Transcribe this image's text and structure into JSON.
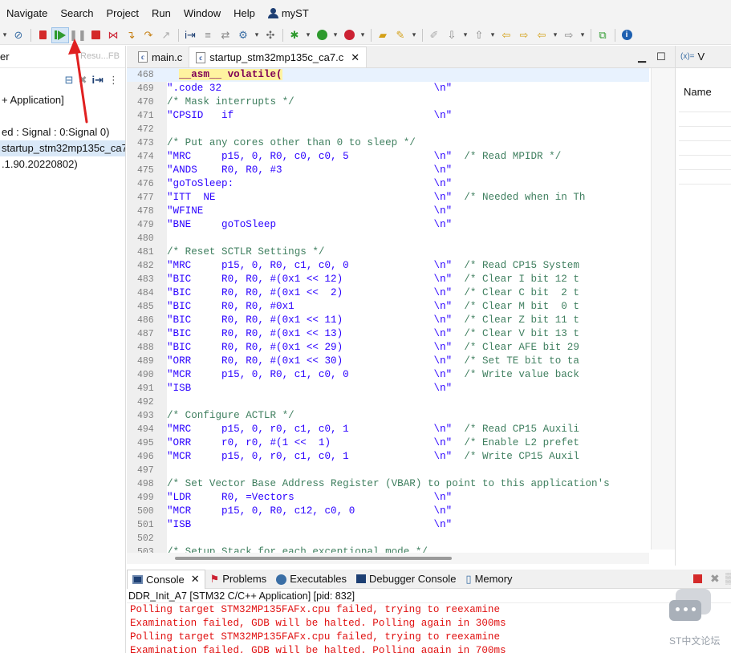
{
  "menubar": {
    "items": [
      "Navigate",
      "Search",
      "Project",
      "Run",
      "Window",
      "Help"
    ],
    "user": "myST"
  },
  "toolbar": {
    "icons": [
      "debug-stop-icon",
      "resume-icon",
      "suspend-icon",
      "terminate-icon",
      "disconnect-icon",
      "step-into-icon",
      "step-over-icon",
      "step-return-icon",
      "instruction-step-icon",
      "use-step-filters-icon",
      "restart-icon",
      "build-icon",
      "run-icon",
      "debug-icon",
      "open-folder-icon",
      "search-icon",
      "back-icon",
      "forward-icon",
      "info-icon"
    ],
    "colors": {
      "highlight": "#d5e6f6",
      "stop_red": "#d42a2a",
      "run_green": "#2e9a2e"
    }
  },
  "left_panel": {
    "title": "er",
    "ghost_text": "Resu...FB",
    "rows": [
      "+ Application]",
      "",
      "ed : Signal : 0:Signal 0)",
      "  startup_stm32mp135c_ca7",
      ".1.90.20220802)"
    ],
    "selected_row": 3
  },
  "editor": {
    "tabs": [
      {
        "label": "main.c",
        "active": false
      },
      {
        "label": "startup_stm32mp135c_ca7.c",
        "active": true
      }
    ],
    "current_line": 468,
    "lines": [
      {
        "n": "468",
        "segments": [
          {
            "t": "  ",
            "k": "s"
          },
          {
            "t": "__asm__ volatile(",
            "k": "kw"
          }
        ]
      },
      {
        "n": "469",
        "segments": [
          {
            "t": "\".code 32                                   \\n\"",
            "k": "s"
          }
        ]
      },
      {
        "n": "470",
        "segments": [
          {
            "t": "/* Mask interrupts */",
            "k": "c"
          }
        ]
      },
      {
        "n": "471",
        "segments": [
          {
            "t": "\"CPSID   if                                 \\n\"",
            "k": "s"
          }
        ]
      },
      {
        "n": "472",
        "segments": [
          {
            "t": "",
            "k": "s"
          }
        ]
      },
      {
        "n": "473",
        "segments": [
          {
            "t": "/* Put any cores other than 0 to sleep */",
            "k": "c"
          }
        ]
      },
      {
        "n": "474",
        "segments": [
          {
            "t": "\"MRC     p15, 0, R0, c0, c0, 5              \\n\"  ",
            "k": "s"
          },
          {
            "t": "/* Read MPIDR */",
            "k": "c"
          }
        ]
      },
      {
        "n": "475",
        "segments": [
          {
            "t": "\"ANDS    R0, R0, #3                         \\n\"",
            "k": "s"
          }
        ]
      },
      {
        "n": "476",
        "segments": [
          {
            "t": "\"goToSleep:                                 \\n\"",
            "k": "s"
          }
        ]
      },
      {
        "n": "477",
        "segments": [
          {
            "t": "\"ITT  NE                                    \\n\"  ",
            "k": "s"
          },
          {
            "t": "/* Needed when in Th",
            "k": "c"
          }
        ]
      },
      {
        "n": "478",
        "segments": [
          {
            "t": "\"WFINE                                      \\n\"",
            "k": "s"
          }
        ]
      },
      {
        "n": "479",
        "segments": [
          {
            "t": "\"BNE     goToSleep                          \\n\"",
            "k": "s"
          }
        ]
      },
      {
        "n": "480",
        "segments": [
          {
            "t": "",
            "k": "s"
          }
        ]
      },
      {
        "n": "481",
        "segments": [
          {
            "t": "/* Reset SCTLR Settings */",
            "k": "c"
          }
        ]
      },
      {
        "n": "482",
        "segments": [
          {
            "t": "\"MRC     p15, 0, R0, c1, c0, 0              \\n\"  ",
            "k": "s"
          },
          {
            "t": "/* Read CP15 System",
            "k": "c"
          }
        ]
      },
      {
        "n": "483",
        "segments": [
          {
            "t": "\"BIC     R0, R0, #(0x1 << 12)               \\n\"  ",
            "k": "s"
          },
          {
            "t": "/* Clear I bit 12 t",
            "k": "c"
          }
        ]
      },
      {
        "n": "484",
        "segments": [
          {
            "t": "\"BIC     R0, R0, #(0x1 <<  2)               \\n\"  ",
            "k": "s"
          },
          {
            "t": "/* Clear C bit  2 t",
            "k": "c"
          }
        ]
      },
      {
        "n": "485",
        "segments": [
          {
            "t": "\"BIC     R0, R0, #0x1                       \\n\"  ",
            "k": "s"
          },
          {
            "t": "/* Clear M bit  0 t",
            "k": "c"
          }
        ]
      },
      {
        "n": "486",
        "segments": [
          {
            "t": "\"BIC     R0, R0, #(0x1 << 11)               \\n\"  ",
            "k": "s"
          },
          {
            "t": "/* Clear Z bit 11 t",
            "k": "c"
          }
        ]
      },
      {
        "n": "487",
        "segments": [
          {
            "t": "\"BIC     R0, R0, #(0x1 << 13)               \\n\"  ",
            "k": "s"
          },
          {
            "t": "/* Clear V bit 13 t",
            "k": "c"
          }
        ]
      },
      {
        "n": "488",
        "segments": [
          {
            "t": "\"BIC     R0, R0, #(0x1 << 29)               \\n\"  ",
            "k": "s"
          },
          {
            "t": "/* Clear AFE bit 29",
            "k": "c"
          }
        ]
      },
      {
        "n": "489",
        "segments": [
          {
            "t": "\"ORR     R0, R0, #(0x1 << 30)               \\n\"  ",
            "k": "s"
          },
          {
            "t": "/* Set TE bit to ta",
            "k": "c"
          }
        ]
      },
      {
        "n": "490",
        "segments": [
          {
            "t": "\"MCR     p15, 0, R0, c1, c0, 0              \\n\"  ",
            "k": "s"
          },
          {
            "t": "/* Write value back",
            "k": "c"
          }
        ]
      },
      {
        "n": "491",
        "segments": [
          {
            "t": "\"ISB                                        \\n\"",
            "k": "s"
          }
        ]
      },
      {
        "n": "492",
        "segments": [
          {
            "t": "",
            "k": "s"
          }
        ]
      },
      {
        "n": "493",
        "segments": [
          {
            "t": "/* Configure ACTLR */",
            "k": "c"
          }
        ]
      },
      {
        "n": "494",
        "segments": [
          {
            "t": "\"MRC     p15, 0, r0, c1, c0, 1              \\n\"  ",
            "k": "s"
          },
          {
            "t": "/* Read CP15 Auxili",
            "k": "c"
          }
        ]
      },
      {
        "n": "495",
        "segments": [
          {
            "t": "\"ORR     r0, r0, #(1 <<  1)                 \\n\"  ",
            "k": "s"
          },
          {
            "t": "/* Enable L2 prefet",
            "k": "c"
          }
        ]
      },
      {
        "n": "496",
        "segments": [
          {
            "t": "\"MCR     p15, 0, r0, c1, c0, 1              \\n\"  ",
            "k": "s"
          },
          {
            "t": "/* Write CP15 Auxil",
            "k": "c"
          }
        ]
      },
      {
        "n": "497",
        "segments": [
          {
            "t": "",
            "k": "s"
          }
        ]
      },
      {
        "n": "498",
        "segments": [
          {
            "t": "/* Set Vector Base Address Register (VBAR) to point to this application's",
            "k": "c"
          }
        ]
      },
      {
        "n": "499",
        "segments": [
          {
            "t": "\"LDR     R0, =Vectors                       \\n\"",
            "k": "s"
          }
        ]
      },
      {
        "n": "500",
        "segments": [
          {
            "t": "\"MCR     p15, 0, R0, c12, c0, 0             \\n\"",
            "k": "s"
          }
        ]
      },
      {
        "n": "501",
        "segments": [
          {
            "t": "\"ISB                                        \\n\"",
            "k": "s"
          }
        ]
      },
      {
        "n": "502",
        "segments": [
          {
            "t": "",
            "k": "s"
          }
        ]
      },
      {
        "n": "503",
        "segments": [
          {
            "t": "/* Setup Stack for each exceptional mode */",
            "k": "c"
          }
        ]
      }
    ]
  },
  "variables_panel": {
    "tab_label": "V",
    "column_header": "Name"
  },
  "console": {
    "tabs": [
      "Console",
      "Problems",
      "Executables",
      "Debugger Console",
      "Memory"
    ],
    "active_tab": 0,
    "title": "DDR_Init_A7 [STM32 C/C++ Application]  [pid: 832]",
    "lines": [
      "Polling target STM32MP135FAFx.cpu failed, trying to reexamine",
      "Examination failed, GDB will be halted. Polling again in 300ms",
      "Polling target STM32MP135FAFx.cpu failed, trying to reexamine",
      "Examination failed, GDB will be halted. Polling again in 700ms"
    ],
    "error_color": "#e01010"
  },
  "watermark": {
    "text": "ST中文论坛"
  }
}
